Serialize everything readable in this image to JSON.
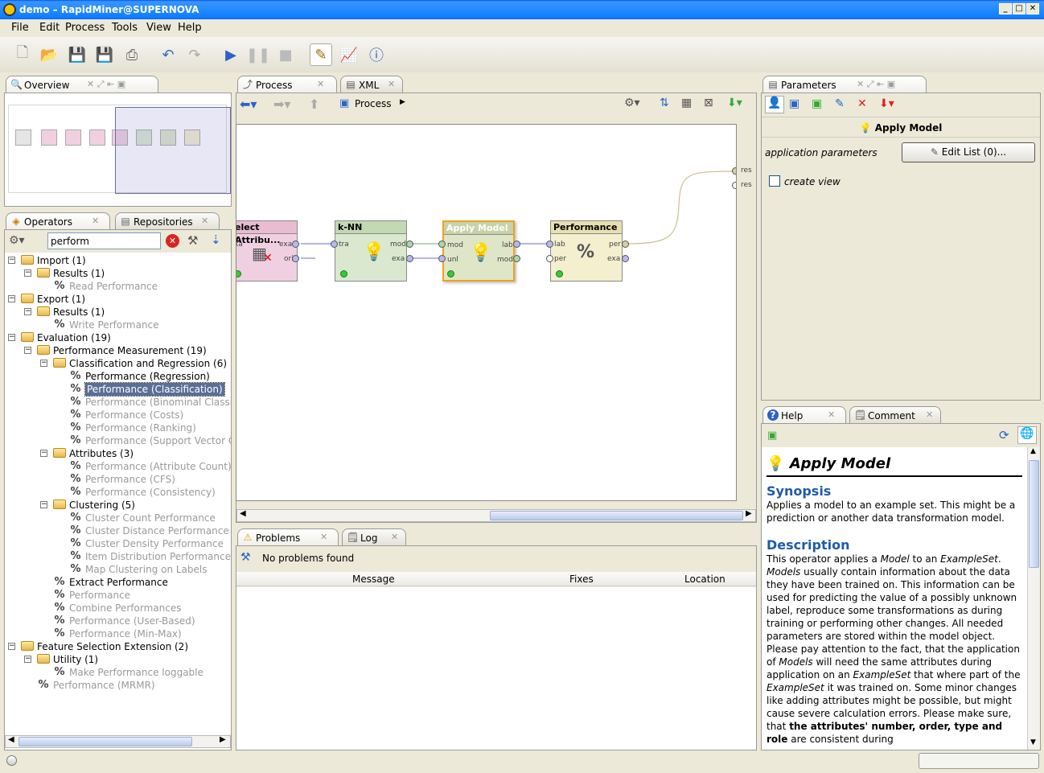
{
  "window": {
    "title": "demo – RapidMiner@SUPERNOVA"
  },
  "menu": [
    "File",
    "Edit",
    "Process",
    "Tools",
    "View",
    "Help"
  ],
  "overview": {
    "tab_label": "Overview"
  },
  "operators": {
    "tab_label": "Operators",
    "repositories_tab": "Repositories",
    "search_value": "perform"
  },
  "tree": [
    {
      "label": "Import (1)",
      "level": 0,
      "type": "folder",
      "disabled": false,
      "exp": "−"
    },
    {
      "label": "Results (1)",
      "level": 1,
      "type": "folder",
      "disabled": false,
      "exp": "−"
    },
    {
      "label": "Read Performance",
      "level": 2,
      "type": "op",
      "disabled": true
    },
    {
      "label": "Export (1)",
      "level": 0,
      "type": "folder",
      "disabled": false,
      "exp": "−"
    },
    {
      "label": "Results (1)",
      "level": 1,
      "type": "folder",
      "disabled": false,
      "exp": "−"
    },
    {
      "label": "Write Performance",
      "level": 2,
      "type": "op",
      "disabled": true
    },
    {
      "label": "Evaluation (19)",
      "level": 0,
      "type": "folder",
      "disabled": false,
      "exp": "−"
    },
    {
      "label": "Performance Measurement (19)",
      "level": 1,
      "type": "folder",
      "disabled": false,
      "exp": "−"
    },
    {
      "label": "Classification and Regression (6)",
      "level": 2,
      "type": "folder",
      "disabled": false,
      "exp": "−"
    },
    {
      "label": "Performance (Regression)",
      "level": 3,
      "type": "op",
      "disabled": false
    },
    {
      "label": "Performance (Classification)",
      "level": 3,
      "type": "op",
      "disabled": false,
      "selected": true
    },
    {
      "label": "Performance (Binominal Classifi",
      "level": 3,
      "type": "op",
      "disabled": true
    },
    {
      "label": "Performance (Costs)",
      "level": 3,
      "type": "op",
      "disabled": true
    },
    {
      "label": "Performance (Ranking)",
      "level": 3,
      "type": "op",
      "disabled": true
    },
    {
      "label": "Performance (Support Vector Cou",
      "level": 3,
      "type": "op",
      "disabled": true
    },
    {
      "label": "Attributes (3)",
      "level": 2,
      "type": "folder",
      "disabled": false,
      "exp": "−"
    },
    {
      "label": "Performance (Attribute Count)",
      "level": 3,
      "type": "op",
      "disabled": true
    },
    {
      "label": "Performance (CFS)",
      "level": 3,
      "type": "op",
      "disabled": true
    },
    {
      "label": "Performance (Consistency)",
      "level": 3,
      "type": "op",
      "disabled": true
    },
    {
      "label": "Clustering (5)",
      "level": 2,
      "type": "folder",
      "disabled": false,
      "exp": "−"
    },
    {
      "label": "Cluster Count Performance",
      "level": 3,
      "type": "op",
      "disabled": true
    },
    {
      "label": "Cluster Distance Performance",
      "level": 3,
      "type": "op",
      "disabled": true
    },
    {
      "label": "Cluster Density Performance",
      "level": 3,
      "type": "op",
      "disabled": true
    },
    {
      "label": "Item Distribution Performance",
      "level": 3,
      "type": "op",
      "disabled": true
    },
    {
      "label": "Map Clustering on Labels",
      "level": 3,
      "type": "op",
      "disabled": true
    },
    {
      "label": "Extract Performance",
      "level": 2,
      "type": "op",
      "disabled": false
    },
    {
      "label": "Performance",
      "level": 2,
      "type": "op",
      "disabled": true
    },
    {
      "label": "Combine Performances",
      "level": 2,
      "type": "op",
      "disabled": true
    },
    {
      "label": "Performance (User-Based)",
      "level": 2,
      "type": "op",
      "disabled": true
    },
    {
      "label": "Performance (Min-Max)",
      "level": 2,
      "type": "op",
      "disabled": true
    },
    {
      "label": "Feature Selection Extension (2)",
      "level": 0,
      "type": "folder",
      "disabled": false,
      "exp": "−"
    },
    {
      "label": "Utility (1)",
      "level": 1,
      "type": "folder",
      "disabled": false,
      "exp": "−"
    },
    {
      "label": "Make Performance loggable",
      "level": 2,
      "type": "op",
      "disabled": true
    },
    {
      "label": "Performance (MRMR)",
      "level": 1,
      "type": "op",
      "disabled": true
    }
  ],
  "process": {
    "tab_label": "Process",
    "xml_tab": "XML",
    "breadcrumb": "Process",
    "operators": {
      "select": "elect Attribu...",
      "knn": "k-NN",
      "apply": "Apply Model",
      "perf": "Performance"
    },
    "ports": {
      "sel_in": "xa",
      "sel_out1": "exa",
      "sel_out2": "ori",
      "knn_in": "tra",
      "knn_out1": "mod",
      "knn_out2": "exa",
      "apply_in1": "mod",
      "apply_in2": "unl",
      "apply_out1": "lab",
      "apply_out2": "mod",
      "perf_in1": "lab",
      "perf_in2": "per",
      "perf_out1": "per",
      "perf_out2": "exa",
      "res1": "res",
      "res2": "res"
    }
  },
  "problems": {
    "tab_label": "Problems",
    "log_tab": "Log",
    "status": "No problems found",
    "col_message": "Message",
    "col_fixes": "Fixes",
    "col_location": "Location"
  },
  "parameters": {
    "tab_label": "Parameters",
    "operator": "Apply Model",
    "param_label": "application parameters",
    "edit_button": "Edit List (0)...",
    "checkbox_label": "create view"
  },
  "help": {
    "tab_label": "Help",
    "comment_tab": "Comment",
    "title": "Apply Model",
    "synopsis_h": "Synopsis",
    "synopsis": "Applies a model to an example set. This might be a prediction or another data transformation model.",
    "description_h": "Description",
    "d1": "This operator applies a ",
    "d1m": "Model",
    "d1b": " to an ",
    "d1e": "ExampleSet",
    "d1c": ". ",
    "d1m2": "Models",
    "d2": " usually contain information about the data they have been trained on. This information can be used for predicting the value of a possibly unknown label, reproduce some transformations as during training or performing other changes. All needed parameters are stored within the model object.",
    "d3a": "Please pay attention to the fact, that the application of ",
    "d3m": "Models",
    "d3b": " will need the same attributes during application on an ",
    "d3e": "ExampleSet",
    "d3c": " that where part of the ",
    "d3e2": "ExampleSet",
    "d3d": " it was trained on. Some minor changes like adding attributes might be possible, but might cause severe calculation errors. Please make sure, that ",
    "d3bold": "the attributes' number, order, type and role",
    "d3f": " are consistent during"
  },
  "colors": {
    "select_op": "#f0d0e0",
    "knn_op": "#d9e8cf",
    "apply_op": "#dfe6c8",
    "perf_op": "#f3efcf",
    "selection": "#5a6f96",
    "title_blue": "#1f5ba8"
  }
}
